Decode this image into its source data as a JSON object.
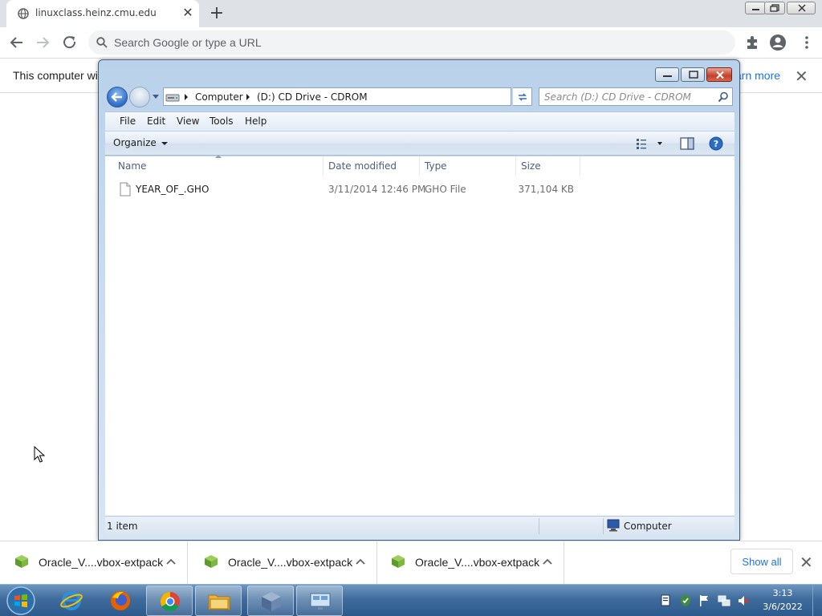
{
  "browser": {
    "tab": {
      "title": "linuxclass.heinz.cmu.edu",
      "close": "✕"
    },
    "new_tab": "+",
    "omnibox": {
      "placeholder": "Search Google or type a URL"
    },
    "infobar": {
      "message": "This computer will",
      "link": "arn more",
      "close": "✕"
    }
  },
  "explorer": {
    "breadcrumb": [
      "Computer",
      "(D:) CD Drive - CDROM"
    ],
    "search_placeholder": "Search (D:) CD Drive - CDROM",
    "menu": [
      "File",
      "Edit",
      "View",
      "Tools",
      "Help"
    ],
    "organize_label": "Organize",
    "columns": [
      "Name",
      "Date modified",
      "Type",
      "Size"
    ],
    "files": [
      {
        "name": "YEAR_OF_.GHO",
        "date_modified": "3/11/2014 12:46 PM",
        "type": "GHO File",
        "size": "371,104 KB"
      }
    ],
    "status": {
      "item_count": "1 item",
      "zone": "Computer"
    }
  },
  "downloads": {
    "items": [
      {
        "name": "Oracle_V....vbox-extpack"
      },
      {
        "name": "Oracle_V....vbox-extpack"
      },
      {
        "name": "Oracle_V....vbox-extpack"
      }
    ],
    "show_all": "Show all",
    "close": "✕"
  },
  "taskbar": {
    "apps": [
      "internet-explorer",
      "firefox",
      "chrome",
      "windows-explorer",
      "virtualbox",
      "remote-desktop"
    ],
    "clock": {
      "time": "3:13",
      "date": "3/6/2022"
    }
  },
  "colors": {
    "link": "#1a73e8",
    "taskbar": "#3f6c9d",
    "explorer_frame": "#b9d1ea"
  }
}
